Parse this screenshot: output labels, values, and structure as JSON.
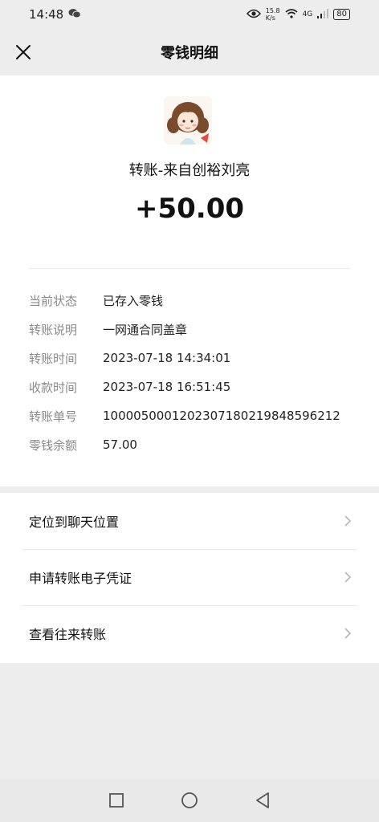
{
  "status_bar": {
    "time": "14:48",
    "speed_value": "15.8",
    "speed_unit": "K/s",
    "network": "4G",
    "battery": "80"
  },
  "header": {
    "title": "零钱明细"
  },
  "transfer": {
    "payer": "转账-来自创裕刘亮",
    "amount": "+50.00"
  },
  "details": [
    {
      "label": "当前状态",
      "value": "已存入零钱"
    },
    {
      "label": "转账说明",
      "value": "一网通合同盖章"
    },
    {
      "label": "转账时间",
      "value": "2023-07-18 14:34:01"
    },
    {
      "label": "收款时间",
      "value": "2023-07-18 16:51:45"
    },
    {
      "label": "转账单号",
      "value": "1000050001202307180219848596212"
    },
    {
      "label": "零钱余额",
      "value": "57.00"
    }
  ],
  "actions": [
    {
      "label": "定位到聊天位置"
    },
    {
      "label": "申请转账电子凭证"
    },
    {
      "label": "查看往来转账"
    }
  ],
  "colors": {
    "page_bg": "#ededed",
    "card_bg": "#ffffff",
    "label_gray": "#8a8a8a"
  },
  "icons": {
    "close": "close-icon",
    "chevron": "chevron-right-icon",
    "wechat": "wechat-icon",
    "eye": "eye-icon",
    "wifi": "wifi-icon",
    "signal": "signal-icon",
    "recent_apps": "square-icon",
    "home": "circle-icon",
    "back": "triangle-back-icon"
  }
}
